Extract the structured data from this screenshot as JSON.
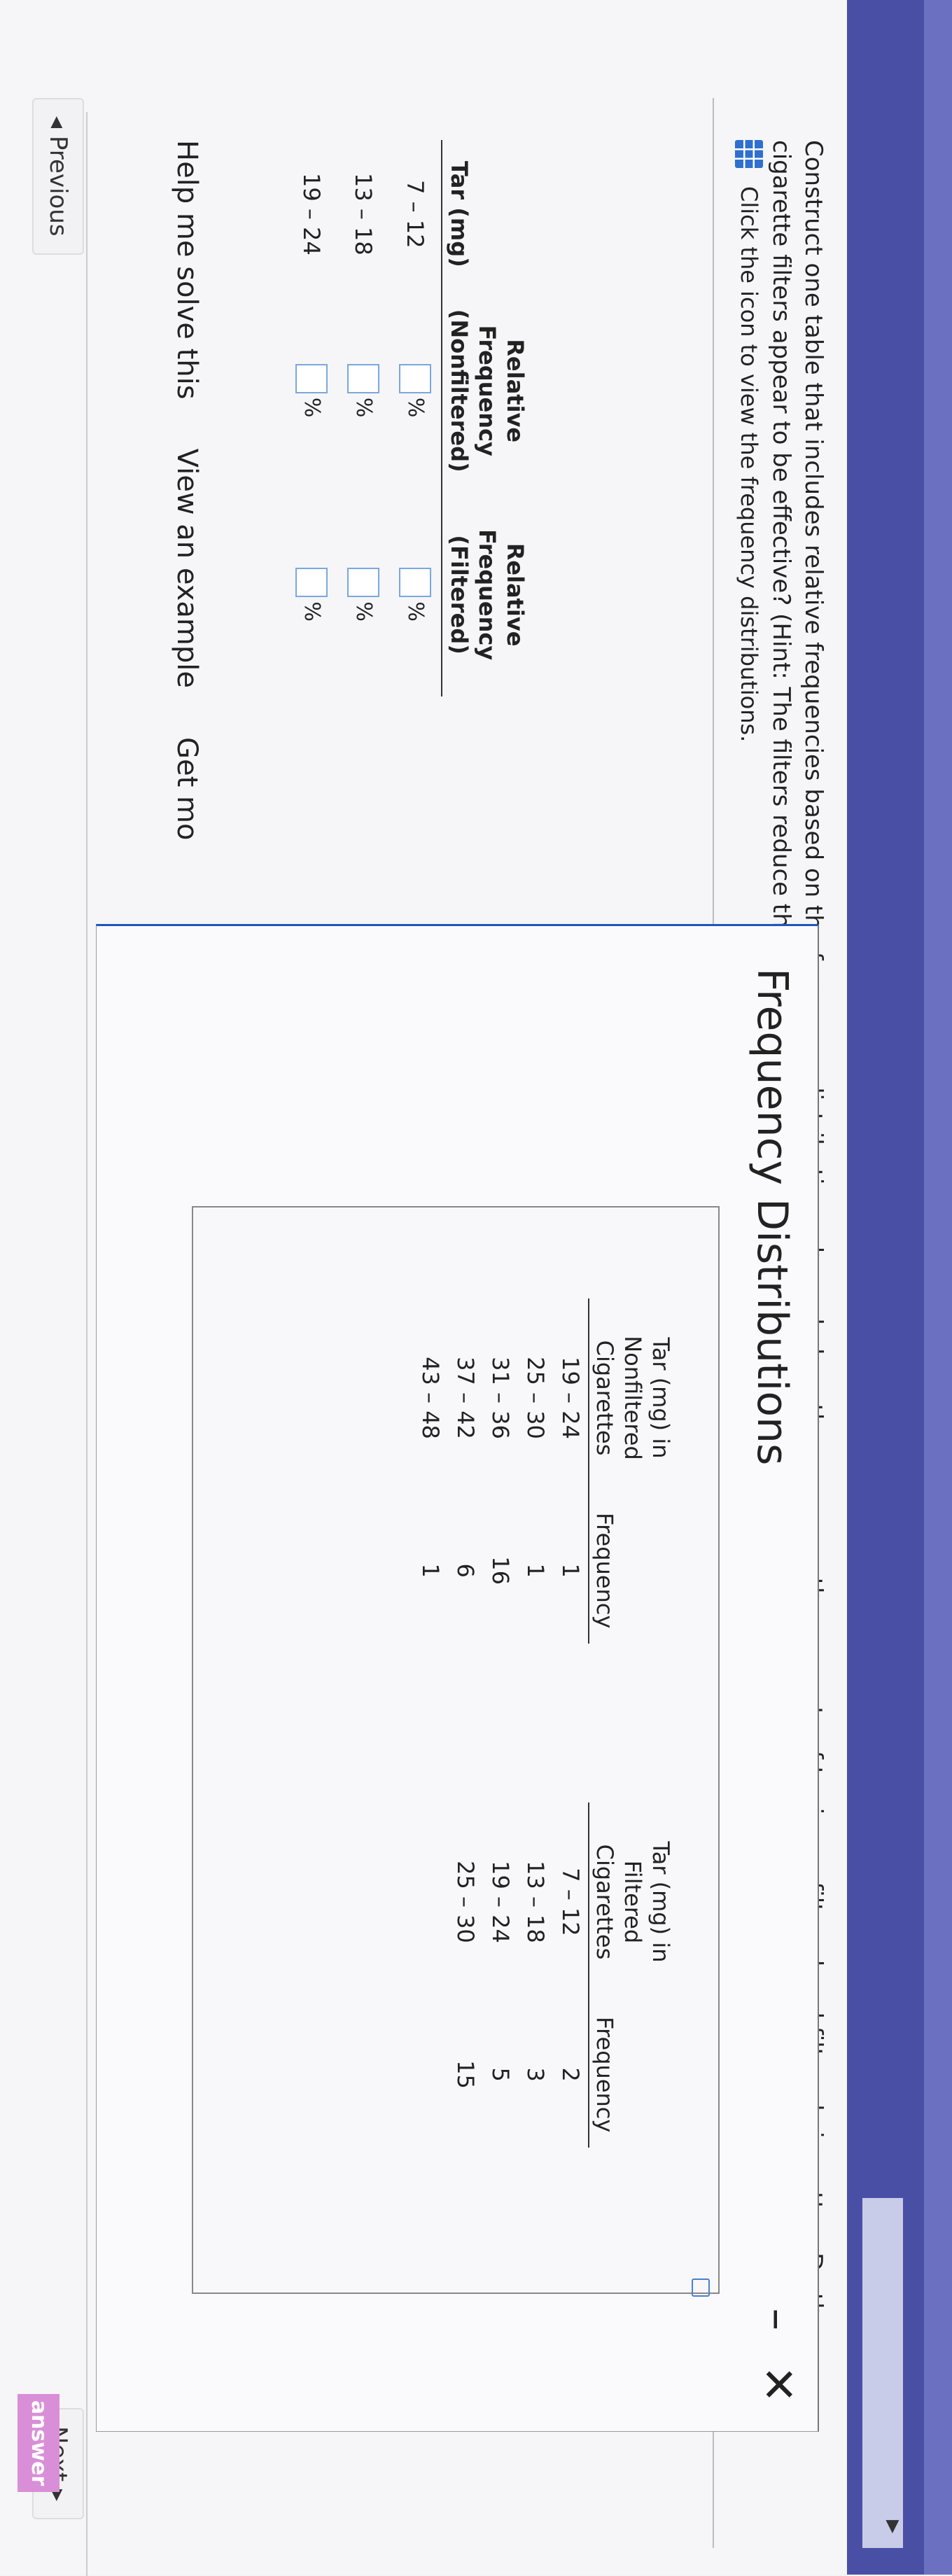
{
  "question": {
    "text": "Construct one table that includes relative frequencies based on the frequency distributions shown below, then compare the amounts of tar in nonfiltered and filtered cigarettes. Do the cigarette filters appear to be effective? (Hint: The filters reduce the amount of tar ingested by the smoker.)",
    "icon_label": "Click the icon to view the frequency distributions."
  },
  "answer_table": {
    "headers": [
      "Tar (mg)",
      "Relative Frequency (Nonfiltered)",
      "Relative Frequency (Filtered)"
    ],
    "rows": [
      {
        "tar": "7 – 12",
        "nonfiltered": "",
        "filtered": ""
      },
      {
        "tar": "13 – 18",
        "nonfiltered": "",
        "filtered": ""
      },
      {
        "tar": "19 – 24",
        "nonfiltered": "",
        "filtered": ""
      }
    ],
    "unit": "%"
  },
  "links": {
    "help": "Help me solve this",
    "example": "View an example",
    "more": "Get mo"
  },
  "modal": {
    "title": "Frequency Distributions",
    "minimize": "–",
    "close": "✕",
    "nonfiltered": {
      "headers": [
        "Tar (mg) in Nonfiltered Cigarettes",
        "Frequency"
      ],
      "rows": [
        [
          "19 – 24",
          "1"
        ],
        [
          "25 – 30",
          "1"
        ],
        [
          "31 – 36",
          "16"
        ],
        [
          "37 – 42",
          "6"
        ],
        [
          "43 – 48",
          "1"
        ]
      ]
    },
    "filtered": {
      "headers": [
        "Tar (mg) in Filtered Cigarettes",
        "Frequency"
      ],
      "rows": [
        [
          "7 – 12",
          "2"
        ],
        [
          "13 – 18",
          "3"
        ],
        [
          "19 – 24",
          "5"
        ],
        [
          "25 – 30",
          "15"
        ]
      ]
    }
  },
  "nav": {
    "previous": "◂ Previous",
    "next": "Next ▸",
    "answer_tab": "answer"
  },
  "colors": {
    "top_band": "#4a4fa6",
    "link_blue": "#1e55c0",
    "answer_tab": "#d98fd8"
  }
}
